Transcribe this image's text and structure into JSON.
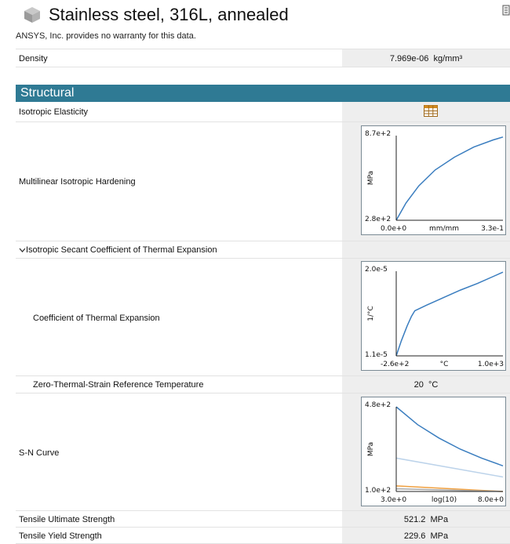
{
  "header": {
    "title": "Stainless steel, 316L, annealed",
    "disclaimer": "ANSYS, Inc. provides no warranty for this data."
  },
  "density": {
    "label": "Density",
    "value": "7.969e-06",
    "unit": "kg/mm³"
  },
  "structural": {
    "section_title": "Structural",
    "isotropic_elasticity": {
      "label": "Isotropic Elasticity",
      "icon": "table-icon"
    },
    "hardening": {
      "label": "Multilinear Isotropic Hardening",
      "chart_data": {
        "type": "line",
        "y_max_label": "8.7e+2",
        "y_min_label": "2.8e+2",
        "x_min_label": "0.0e+0",
        "x_max_label": "3.3e-1",
        "xlabel": "mm/mm",
        "ylabel": "MPa",
        "xlim": [
          0,
          0.33
        ],
        "ylim": [
          280,
          870
        ],
        "series": [
          {
            "color": "#3a7dbf",
            "x": [
              0,
              0.03,
              0.07,
              0.12,
              0.18,
              0.24,
              0.3,
              0.33
            ],
            "y": [
              280,
              400,
              520,
              630,
              720,
              790,
              840,
              860
            ]
          }
        ]
      }
    },
    "thermal_expansion": {
      "group_label": "Isotropic Secant Coefficient of Thermal Expansion",
      "cte_label": "Coefficient of Thermal Expansion",
      "chart_data": {
        "type": "line",
        "y_max_label": "2.0e-5",
        "y_min_label": "1.1e-5",
        "x_min_label": "-2.6e+2",
        "x_max_label": "1.0e+3",
        "xlabel": "°C",
        "ylabel": "1/°C",
        "xlim": [
          -260,
          1000
        ],
        "ylim": [
          1.1e-05,
          2e-05
        ],
        "series": [
          {
            "color": "#3a7dbf",
            "x": [
              -260,
              -200,
              -130,
              -80,
              -40,
              100,
              300,
              500,
              700,
              900,
              1000
            ],
            "y": [
              1.1e-05,
              1.26e-05,
              1.42e-05,
              1.52e-05,
              1.58e-05,
              1.64e-05,
              1.72e-05,
              1.8e-05,
              1.87e-05,
              1.95e-05,
              1.99e-05
            ]
          }
        ]
      },
      "ref_temp_label": "Zero-Thermal-Strain Reference Temperature",
      "ref_temp_value": "20",
      "ref_temp_unit": "°C"
    },
    "sn_curve": {
      "label": "S-N Curve",
      "chart_data": {
        "type": "line",
        "y_max_label": "4.8e+2",
        "y_min_label": "1.0e+2",
        "x_min_label": "3.0e+0",
        "x_max_label": "8.0e+0",
        "xlabel": "log(10)",
        "ylabel": "MPa",
        "xlim": [
          3,
          8
        ],
        "ylim": [
          100,
          480
        ],
        "series": [
          {
            "color": "#3a7dbf",
            "x": [
              3,
              4,
              5,
              6,
              7,
              8
            ],
            "y": [
              480,
              400,
              340,
              290,
              250,
              215
            ]
          },
          {
            "color": "#bcd3ea",
            "x": [
              3,
              8
            ],
            "y": [
              250,
              165
            ]
          },
          {
            "color": "#f0a040",
            "x": [
              3,
              8
            ],
            "y": [
              125,
              100
            ]
          },
          {
            "color": "#a8a8a8",
            "x": [
              3,
              8
            ],
            "y": [
              112,
              100
            ]
          }
        ]
      }
    },
    "tensile_ultimate": {
      "label": "Tensile Ultimate Strength",
      "value": "521.2",
      "unit": "MPa"
    },
    "tensile_yield": {
      "label": "Tensile Yield Strength",
      "value": "229.6",
      "unit": "MPa"
    }
  }
}
